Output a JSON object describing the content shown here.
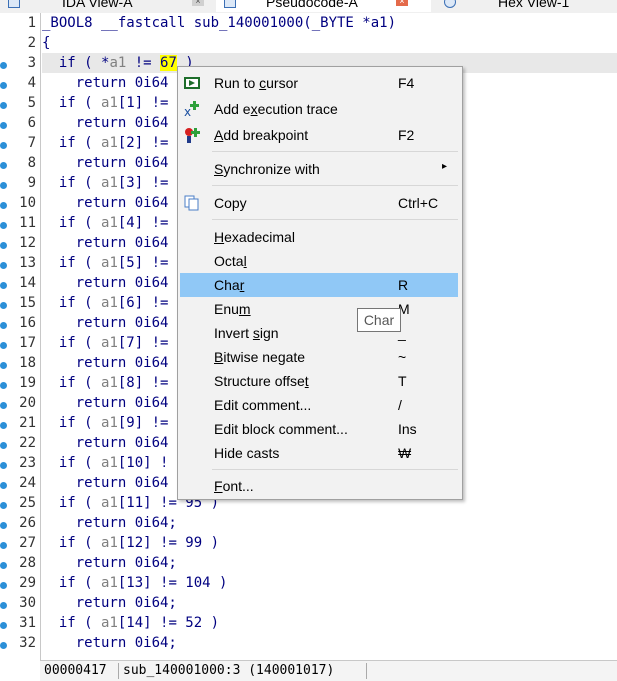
{
  "tabs": [
    {
      "label": "IDA View-A"
    },
    {
      "label": "Pseudocode-A"
    },
    {
      "label": "Hex View-1"
    }
  ],
  "line_numbers": [
    "1",
    "2",
    "3",
    "4",
    "5",
    "6",
    "7",
    "8",
    "9",
    "10",
    "11",
    "12",
    "13",
    "14",
    "15",
    "16",
    "17",
    "18",
    "19",
    "20",
    "21",
    "22",
    "23",
    "24",
    "25",
    "26",
    "27",
    "28",
    "29",
    "30",
    "31",
    "32"
  ],
  "code": {
    "signature": "_BOOL8 __fastcall sub_140001000(_BYTE *a1)",
    "open_brace": "{",
    "line3_pre": "  if ( *",
    "line3_var": "a1",
    "line3_mid": " != ",
    "line3_val": "67",
    "line3_post": " )",
    "return_stmt": "    return 0i64;",
    "return_partial": "    return 0i64",
    "if_lines": [
      {
        "pre": "  if ( ",
        "var": "a1",
        "rest": "[1] !="
      },
      {
        "pre": "  if ( ",
        "var": "a1",
        "rest": "[2] !="
      },
      {
        "pre": "  if ( ",
        "var": "a1",
        "rest": "[3] !="
      },
      {
        "pre": "  if ( ",
        "var": "a1",
        "rest": "[4] !="
      },
      {
        "pre": "  if ( ",
        "var": "a1",
        "rest": "[5] !="
      },
      {
        "pre": "  if ( ",
        "var": "a1",
        "rest": "[6] !="
      },
      {
        "pre": "  if ( ",
        "var": "a1",
        "rest": "[7] !="
      },
      {
        "pre": "  if ( ",
        "var": "a1",
        "rest": "[8] !="
      },
      {
        "pre": "  if ( ",
        "var": "a1",
        "rest": "[9] !="
      },
      {
        "pre": "  if ( ",
        "var": "a1",
        "rest": "[10] !"
      },
      {
        "pre": "  if ( ",
        "var": "a1",
        "rest": "[11] != 95 )"
      },
      {
        "pre": "  if ( ",
        "var": "a1",
        "rest": "[12] != 99 )"
      },
      {
        "pre": "  if ( ",
        "var": "a1",
        "rest": "[13] != 104 )"
      },
      {
        "pre": "  if ( ",
        "var": "a1",
        "rest": "[14] != 52 )"
      }
    ]
  },
  "status": {
    "offset": "00000417",
    "location": "sub_140001000:3 (140001017)"
  },
  "context_menu": {
    "run_to_cursor": {
      "label_pre": "Run to ",
      "label_u": "c",
      "label_post": "ursor",
      "shortcut": "F4"
    },
    "add_execution_trace": {
      "label_pre": "Add e",
      "label_u": "x",
      "label_post": "ecution trace",
      "shortcut": ""
    },
    "add_breakpoint": {
      "label_pre": "",
      "label_u": "A",
      "label_post": "dd breakpoint",
      "shortcut": "F2"
    },
    "synchronize_with": {
      "label_pre": "",
      "label_u": "S",
      "label_post": "ynchronize with",
      "shortcut": ""
    },
    "copy": {
      "label_pre": "Copy",
      "label_u": "",
      "label_post": "",
      "shortcut": "Ctrl+C"
    },
    "hexadecimal": {
      "label_pre": "",
      "label_u": "H",
      "label_post": "exadecimal",
      "shortcut": ""
    },
    "octal": {
      "label_pre": "Octa",
      "label_u": "l",
      "label_post": "",
      "shortcut": ""
    },
    "char": {
      "label_pre": "Cha",
      "label_u": "r",
      "label_post": "",
      "shortcut": "R"
    },
    "enum": {
      "label_pre": "Enu",
      "label_u": "m",
      "label_post": "",
      "shortcut": "M"
    },
    "invert_sign": {
      "label_pre": "Invert ",
      "label_u": "s",
      "label_post": "ign",
      "shortcut": "_"
    },
    "bitwise_negate": {
      "label_pre": "",
      "label_u": "B",
      "label_post": "itwise negate",
      "shortcut": "~"
    },
    "structure_offset": {
      "label_pre": "Structure offse",
      "label_u": "t",
      "label_post": "",
      "shortcut": "T"
    },
    "edit_comment": {
      "label_pre": "Edit comment...",
      "label_u": "",
      "label_post": "",
      "shortcut": "/"
    },
    "edit_block_comment": {
      "label_pre": "Edit block comment...",
      "label_u": "",
      "label_post": "",
      "shortcut": "Ins"
    },
    "hide_casts": {
      "label_pre": "Hide casts",
      "label_u": "",
      "label_post": "",
      "shortcut": "₩"
    },
    "font": {
      "label_pre": "",
      "label_u": "F",
      "label_post": "ont...",
      "shortcut": ""
    }
  },
  "tooltip": {
    "text": "Char"
  },
  "colors": {
    "highlight_bg": "#90c8f6",
    "breakpoint_dot": "#2b8fd8",
    "number_highlight": "#ffff00",
    "current_line": "#e8e8e8"
  },
  "icons": {
    "run_to_cursor": "run-to-cursor-icon",
    "add_execution_trace": "add-trace-icon",
    "add_breakpoint": "add-breakpoint-icon",
    "copy": "copy-icon",
    "submenu": "chevron-right-icon"
  }
}
